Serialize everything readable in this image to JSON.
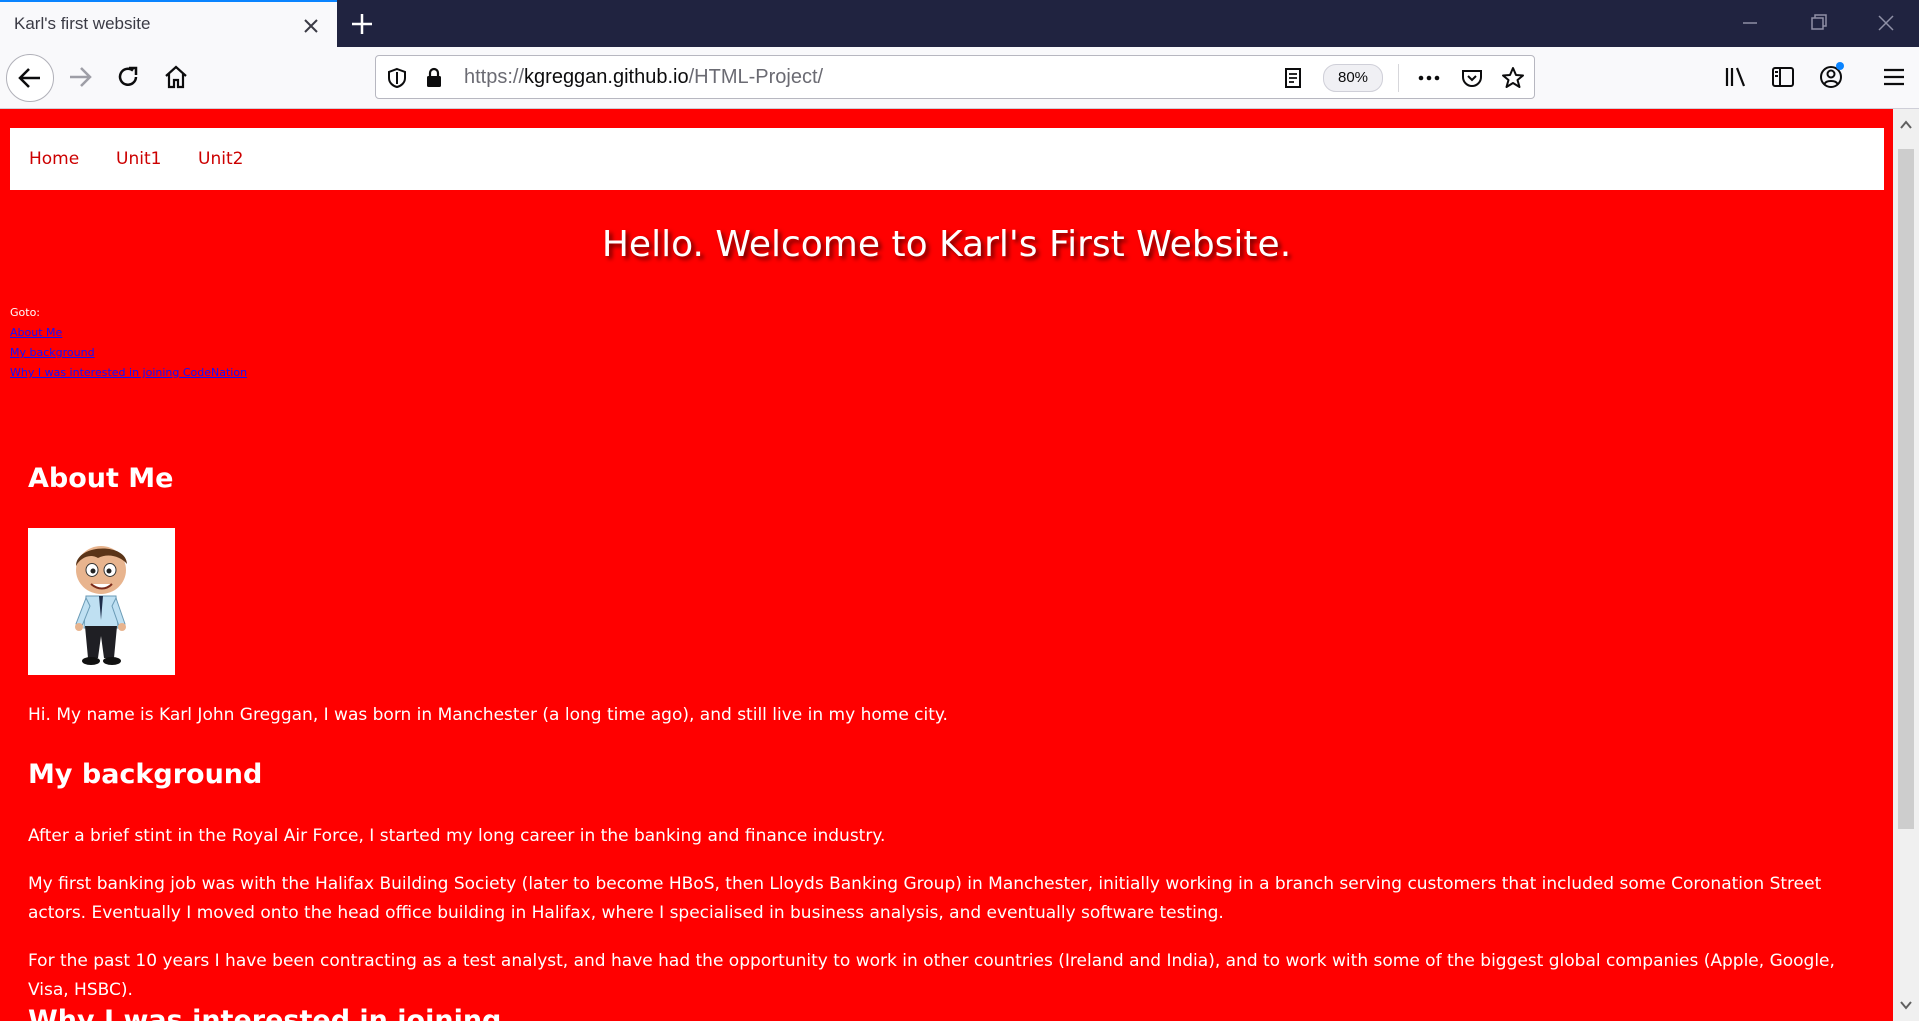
{
  "browser": {
    "tab_title": "Karl's first website",
    "url_scheme": "https://",
    "url_domain": "kgreggan.github.io",
    "url_path": "/HTML-Project/",
    "zoom": "80%"
  },
  "nav": {
    "items": [
      "Home",
      "Unit1",
      "Unit2"
    ]
  },
  "hero": {
    "title": "Hello. Welcome to Karl's First Website."
  },
  "goto": {
    "label": "Goto:",
    "links": [
      "About Me",
      "My background",
      "Why I was interested in joining CodeNation"
    ]
  },
  "about": {
    "heading": "About Me",
    "text": "Hi. My name is Karl John Greggan, I was born in Manchester (a long time ago), and still live in my home city."
  },
  "background": {
    "heading": "My background",
    "p1": "After a brief stint in the Royal Air Force, I started my long career in the banking and finance industry.",
    "p2": "My first banking job was with the Halifax Building Society (later to become HBoS, then Lloyds Banking Group) in Manchester, initially working in a branch serving customers that included some Coronation Street actors. Eventually I moved onto the head office building in Halifax, where I specialised in business analysis, and eventually software testing.",
    "p3": "For the past 10 years I have been contracting as a test analyst, and have had the opportunity to work in other countries (Ireland and India), and to work with some of the biggest global companies (Apple, Google, Visa, HSBC)."
  },
  "why": {
    "heading": "Why I was interested in joining"
  },
  "colors": {
    "page_bg": "#ff0000",
    "nav_link": "#cc0000",
    "goto_link": "#1010ff"
  }
}
